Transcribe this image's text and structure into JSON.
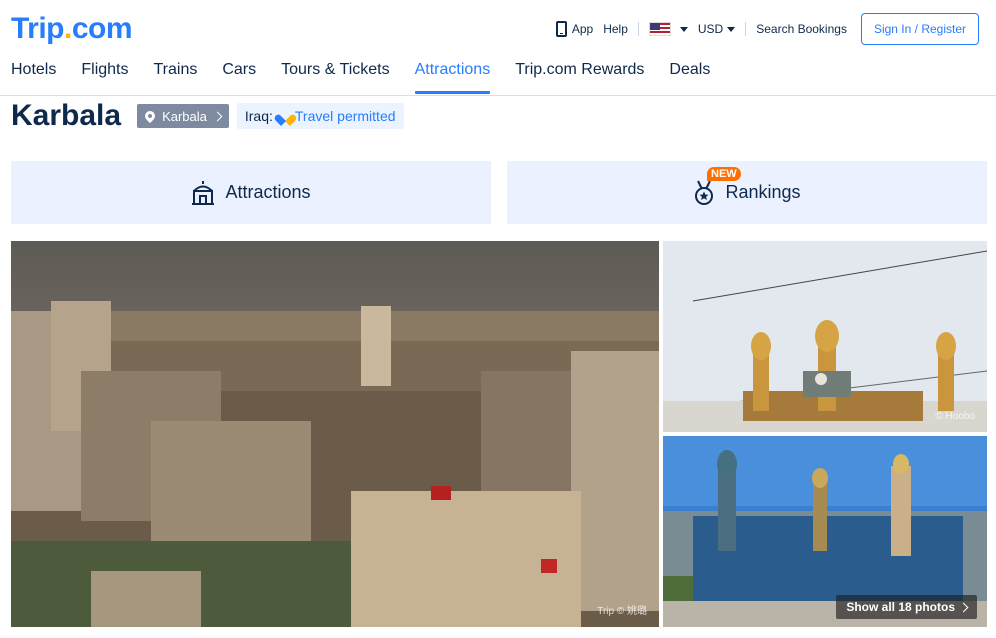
{
  "header": {
    "logo_main": "Trip",
    "logo_dot": ".",
    "logo_tail": "com",
    "app_label": "App",
    "help_label": "Help",
    "currency": "USD",
    "search_bookings": "Search Bookings",
    "signin_label": "Sign In / Register"
  },
  "nav": {
    "items": [
      {
        "label": "Hotels"
      },
      {
        "label": "Flights"
      },
      {
        "label": "Trains"
      },
      {
        "label": "Cars"
      },
      {
        "label": "Tours & Tickets"
      },
      {
        "label": "Attractions"
      },
      {
        "label": "Trip.com Rewards"
      },
      {
        "label": "Deals"
      }
    ],
    "active": "Attractions"
  },
  "page": {
    "title": "Karbala",
    "location_badge": "Karbala",
    "country_label": "Iraq:",
    "travel_status": "Travel permitted"
  },
  "categories": {
    "attractions_label": "Attractions",
    "rankings_label": "Rankings",
    "new_badge": "NEW"
  },
  "photos": {
    "watermark_main": "Trip © 姚璐",
    "watermark_tr": "© Hoobo",
    "show_all_label": "Show all 18 photos"
  },
  "colors": {
    "brand_blue": "#287dfa",
    "brand_yellow": "#ffb400",
    "text_dark": "#0f294d",
    "new_orange": "#ff6f00"
  }
}
